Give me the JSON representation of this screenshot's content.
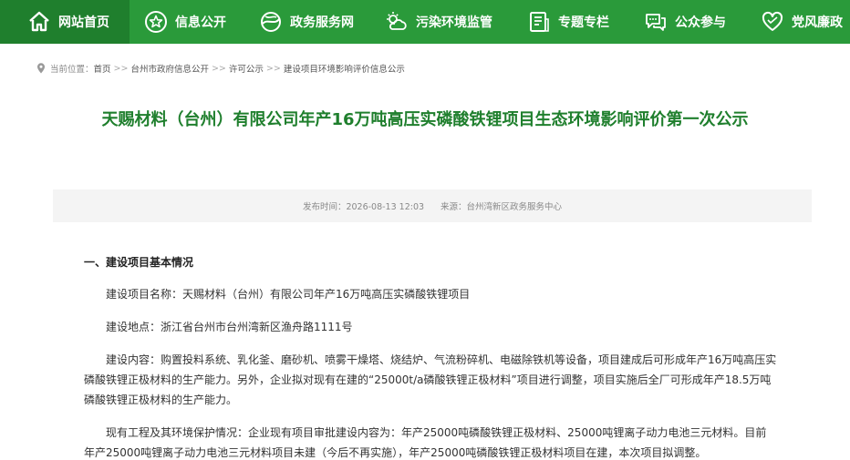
{
  "nav": {
    "items": [
      {
        "label": "网站首页",
        "icon": "home-icon"
      },
      {
        "label": "信息公开",
        "icon": "star-circle-icon"
      },
      {
        "label": "政务服务网",
        "icon": "globe-icon"
      },
      {
        "label": "污染环境监管",
        "icon": "weather-icon"
      },
      {
        "label": "专题专栏",
        "icon": "document-icon"
      },
      {
        "label": "公众参与",
        "icon": "chat-icon"
      },
      {
        "label": "党风廉政",
        "icon": "heart-icon"
      }
    ],
    "colors": {
      "bar": "#2a9a3a",
      "active": "#1f7f2d"
    }
  },
  "breadcrumb": {
    "prefix": "当前位置：",
    "items": [
      "首页",
      "台州市政府信息公开",
      "许可公示",
      "建设项目环境影响评价信息公示"
    ],
    "separator": ">>"
  },
  "article": {
    "title": "天赐材料（台州）有限公司年产16万吨高压实磷酸铁锂项目生态环境影响评价第一次公示",
    "publish_time": "发布时间：2026-08-13 12:03",
    "source": "来源：台州湾新区政务服务中心",
    "section1_heading": "一、建设项目基本情况",
    "paragraphs": [
      "建设项目名称：天赐材料（台州）有限公司年产16万吨高压实磷酸铁锂项目",
      "建设地点：浙江省台州市台州湾新区渔舟路1111号",
      "建设内容：购置投料系统、乳化釜、磨砂机、喷雾干燥塔、烧结炉、气流粉碎机、电磁除铁机等设备，项目建成后可形成年产16万吨高压实磷酸铁锂正极材料的生产能力。另外，企业拟对现有在建的“25000t/a磷酸铁锂正极材料”项目进行调整，项目实施后全厂可形成年产18.5万吨磷酸铁锂正极材料的生产能力。",
      "现有工程及其环境保护情况：企业现有项目审批建设内容为：年产25000吨磷酸铁锂正极材料、25000吨锂离子动力电池三元材料。目前年产25000吨锂离子动力电池三元材料项目未建（今后不再实施），年产25000吨磷酸铁锂正极材料项目在建，本次项目拟调整。"
    ]
  }
}
